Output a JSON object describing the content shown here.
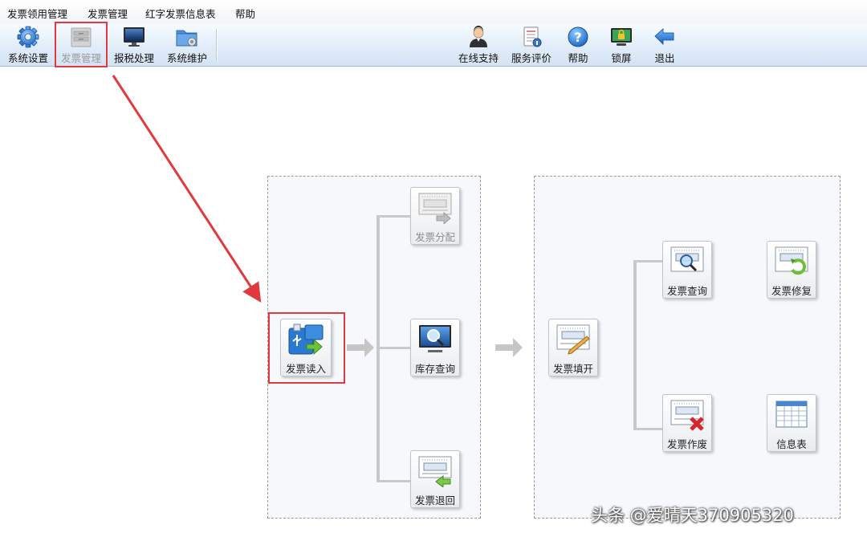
{
  "menu": [
    {
      "label": "发票领用管理"
    },
    {
      "label": "发票管理"
    },
    {
      "label": "红字发票信息表"
    },
    {
      "label": "帮助"
    }
  ],
  "toolbar": {
    "left": [
      {
        "label": "系统设置",
        "icon": "gear-icon"
      },
      {
        "label": "发票管理",
        "icon": "invoice-cabinet-icon",
        "disabled": true,
        "highlighted": true
      },
      {
        "label": "报税处理",
        "icon": "monitor-icon"
      },
      {
        "label": "系统维护",
        "icon": "folder-gear-icon"
      }
    ],
    "right": [
      {
        "label": "在线支持",
        "icon": "support-person-icon"
      },
      {
        "label": "服务评价",
        "icon": "rating-document-icon"
      },
      {
        "label": "帮助",
        "icon": "help-icon"
      },
      {
        "label": "锁屏",
        "icon": "lock-screen-icon"
      },
      {
        "label": "退出",
        "icon": "exit-arrow-icon"
      }
    ]
  },
  "workflow": {
    "left_panel": {
      "read": {
        "label": "发票读入",
        "icon": "usb-read-icon",
        "highlighted": true
      },
      "distribute": {
        "label": "发票分配",
        "icon": "invoice-distribute-icon",
        "disabled": true
      },
      "stock_query": {
        "label": "库存查询",
        "icon": "monitor-search-icon"
      },
      "return": {
        "label": "发票退回",
        "icon": "invoice-return-icon"
      }
    },
    "right_panel": {
      "issue": {
        "label": "发票填开",
        "icon": "invoice-write-icon"
      },
      "query": {
        "label": "发票查询",
        "icon": "invoice-search-icon"
      },
      "repair": {
        "label": "发票修复",
        "icon": "invoice-repair-icon"
      },
      "void": {
        "label": "发票作废",
        "icon": "invoice-void-icon"
      },
      "info_table": {
        "label": "信息表",
        "icon": "table-icon"
      }
    }
  },
  "colors": {
    "highlight": "#e03a3e",
    "toolbar_top": "#f7fbff",
    "toolbar_bottom": "#d3e3f4",
    "panel_bg": "#f6f8fb",
    "connector": "#c9c9c9"
  },
  "watermark": "头条 @爱晴天370905320"
}
